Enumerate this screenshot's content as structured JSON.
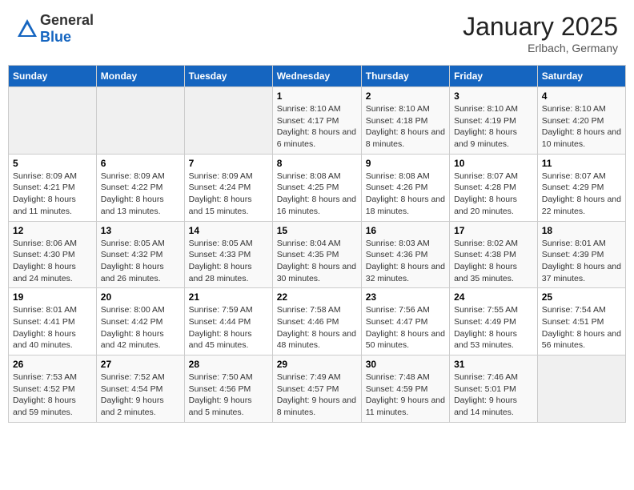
{
  "header": {
    "logo_general": "General",
    "logo_blue": "Blue",
    "month_title": "January 2025",
    "location": "Erlbach, Germany"
  },
  "weekdays": [
    "Sunday",
    "Monday",
    "Tuesday",
    "Wednesday",
    "Thursday",
    "Friday",
    "Saturday"
  ],
  "weeks": [
    [
      {
        "day": "",
        "info": ""
      },
      {
        "day": "",
        "info": ""
      },
      {
        "day": "",
        "info": ""
      },
      {
        "day": "1",
        "info": "Sunrise: 8:10 AM\nSunset: 4:17 PM\nDaylight: 8 hours and 6 minutes."
      },
      {
        "day": "2",
        "info": "Sunrise: 8:10 AM\nSunset: 4:18 PM\nDaylight: 8 hours and 8 minutes."
      },
      {
        "day": "3",
        "info": "Sunrise: 8:10 AM\nSunset: 4:19 PM\nDaylight: 8 hours and 9 minutes."
      },
      {
        "day": "4",
        "info": "Sunrise: 8:10 AM\nSunset: 4:20 PM\nDaylight: 8 hours and 10 minutes."
      }
    ],
    [
      {
        "day": "5",
        "info": "Sunrise: 8:09 AM\nSunset: 4:21 PM\nDaylight: 8 hours and 11 minutes."
      },
      {
        "day": "6",
        "info": "Sunrise: 8:09 AM\nSunset: 4:22 PM\nDaylight: 8 hours and 13 minutes."
      },
      {
        "day": "7",
        "info": "Sunrise: 8:09 AM\nSunset: 4:24 PM\nDaylight: 8 hours and 15 minutes."
      },
      {
        "day": "8",
        "info": "Sunrise: 8:08 AM\nSunset: 4:25 PM\nDaylight: 8 hours and 16 minutes."
      },
      {
        "day": "9",
        "info": "Sunrise: 8:08 AM\nSunset: 4:26 PM\nDaylight: 8 hours and 18 minutes."
      },
      {
        "day": "10",
        "info": "Sunrise: 8:07 AM\nSunset: 4:28 PM\nDaylight: 8 hours and 20 minutes."
      },
      {
        "day": "11",
        "info": "Sunrise: 8:07 AM\nSunset: 4:29 PM\nDaylight: 8 hours and 22 minutes."
      }
    ],
    [
      {
        "day": "12",
        "info": "Sunrise: 8:06 AM\nSunset: 4:30 PM\nDaylight: 8 hours and 24 minutes."
      },
      {
        "day": "13",
        "info": "Sunrise: 8:05 AM\nSunset: 4:32 PM\nDaylight: 8 hours and 26 minutes."
      },
      {
        "day": "14",
        "info": "Sunrise: 8:05 AM\nSunset: 4:33 PM\nDaylight: 8 hours and 28 minutes."
      },
      {
        "day": "15",
        "info": "Sunrise: 8:04 AM\nSunset: 4:35 PM\nDaylight: 8 hours and 30 minutes."
      },
      {
        "day": "16",
        "info": "Sunrise: 8:03 AM\nSunset: 4:36 PM\nDaylight: 8 hours and 32 minutes."
      },
      {
        "day": "17",
        "info": "Sunrise: 8:02 AM\nSunset: 4:38 PM\nDaylight: 8 hours and 35 minutes."
      },
      {
        "day": "18",
        "info": "Sunrise: 8:01 AM\nSunset: 4:39 PM\nDaylight: 8 hours and 37 minutes."
      }
    ],
    [
      {
        "day": "19",
        "info": "Sunrise: 8:01 AM\nSunset: 4:41 PM\nDaylight: 8 hours and 40 minutes."
      },
      {
        "day": "20",
        "info": "Sunrise: 8:00 AM\nSunset: 4:42 PM\nDaylight: 8 hours and 42 minutes."
      },
      {
        "day": "21",
        "info": "Sunrise: 7:59 AM\nSunset: 4:44 PM\nDaylight: 8 hours and 45 minutes."
      },
      {
        "day": "22",
        "info": "Sunrise: 7:58 AM\nSunset: 4:46 PM\nDaylight: 8 hours and 48 minutes."
      },
      {
        "day": "23",
        "info": "Sunrise: 7:56 AM\nSunset: 4:47 PM\nDaylight: 8 hours and 50 minutes."
      },
      {
        "day": "24",
        "info": "Sunrise: 7:55 AM\nSunset: 4:49 PM\nDaylight: 8 hours and 53 minutes."
      },
      {
        "day": "25",
        "info": "Sunrise: 7:54 AM\nSunset: 4:51 PM\nDaylight: 8 hours and 56 minutes."
      }
    ],
    [
      {
        "day": "26",
        "info": "Sunrise: 7:53 AM\nSunset: 4:52 PM\nDaylight: 8 hours and 59 minutes."
      },
      {
        "day": "27",
        "info": "Sunrise: 7:52 AM\nSunset: 4:54 PM\nDaylight: 9 hours and 2 minutes."
      },
      {
        "day": "28",
        "info": "Sunrise: 7:50 AM\nSunset: 4:56 PM\nDaylight: 9 hours and 5 minutes."
      },
      {
        "day": "29",
        "info": "Sunrise: 7:49 AM\nSunset: 4:57 PM\nDaylight: 9 hours and 8 minutes."
      },
      {
        "day": "30",
        "info": "Sunrise: 7:48 AM\nSunset: 4:59 PM\nDaylight: 9 hours and 11 minutes."
      },
      {
        "day": "31",
        "info": "Sunrise: 7:46 AM\nSunset: 5:01 PM\nDaylight: 9 hours and 14 minutes."
      },
      {
        "day": "",
        "info": ""
      }
    ]
  ]
}
